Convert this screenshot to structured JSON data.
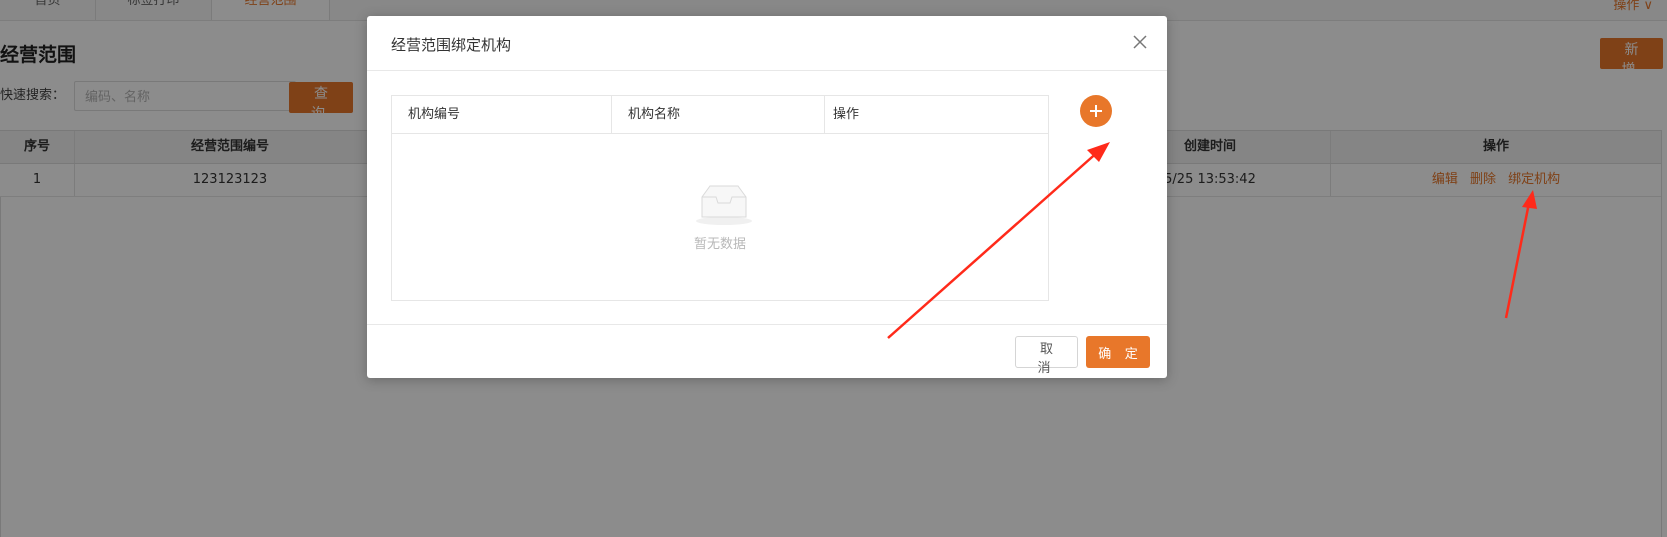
{
  "tabs": [
    {
      "label": "首页"
    },
    {
      "label": "标签打印"
    },
    {
      "label": "经营范围"
    }
  ],
  "top_ops": {
    "label": "操作 ∨"
  },
  "page": {
    "title": "经营范围",
    "new_button": "新 增",
    "search": {
      "label": "快速搜索：",
      "placeholder": "编码、名称",
      "button": "查 询"
    }
  },
  "grid": {
    "columns": [
      "序号",
      "经营范围编号",
      "创建时间",
      "操作"
    ],
    "rows": [
      {
        "index": "1",
        "code": "123123123",
        "created": "5/25 13:53:42"
      }
    ],
    "row_actions": {
      "edit": "编辑",
      "delete": "删除",
      "bind": "绑定机构"
    }
  },
  "dialog": {
    "title": "经营范围绑定机构",
    "table_columns": [
      "机构编号",
      "机构名称",
      "操作"
    ],
    "empty_text": "暂无数据",
    "add_icon": "plus-icon",
    "cancel": "取 消",
    "ok": "确 定"
  },
  "colors": {
    "accent": "#e8772a",
    "annotation": "#ff2a1a"
  }
}
